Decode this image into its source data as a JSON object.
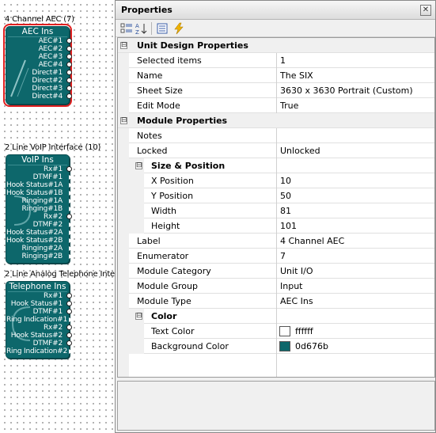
{
  "canvas": {
    "modules": [
      {
        "caption": "4 Channel AEC (7)",
        "title": "AEC Ins",
        "pins": [
          "AEC#1",
          "AEC#2",
          "AEC#3",
          "AEC#4",
          "Direct#1",
          "Direct#2",
          "Direct#3",
          "Direct#4"
        ]
      },
      {
        "caption": "2 Line VoIP Interface (10)",
        "title": "VoIP Ins",
        "pins": [
          "Rx#1",
          "DTMF#1",
          "Hook Status#1A",
          "Hook Status#1B",
          "Ringing#1A",
          "Ringing#1B",
          "Rx#2",
          "DTMF#2",
          "Hook Status#2A",
          "Hook Status#2B",
          "Ringing#2A",
          "Ringing#2B"
        ]
      },
      {
        "caption": "2 Line Analog Telephone Inte",
        "title": "Telephone Ins",
        "pins": [
          "Rx#1",
          "Hook Status#1",
          "DTMF#1",
          "Ring Indication#1",
          "Rx#2",
          "Hook Status#2",
          "DTMF#2",
          "Ring Indication#2"
        ]
      }
    ]
  },
  "properties": {
    "window_title": "Properties",
    "close_icon": "close-icon",
    "toolbar": {
      "categorized": "categorized-icon",
      "alphabetical": "sort-alpha-icon",
      "property_pages": "property-pages-icon",
      "events": "lightning-icon"
    },
    "unit_design": {
      "label": "Unit Design Properties",
      "toggle": "⊟",
      "selected_items": {
        "name": "Selected items",
        "value": "1"
      },
      "name": {
        "name": "Name",
        "value": "The SIX"
      },
      "sheet_size": {
        "name": "Sheet Size",
        "value": "3630 x 3630 Portrait (Custom)"
      },
      "edit_mode": {
        "name": "Edit Mode",
        "value": "True"
      }
    },
    "module": {
      "label": "Module Properties",
      "toggle": "⊟",
      "notes": {
        "name": "Notes",
        "value": ""
      },
      "locked": {
        "name": "Locked",
        "value": "Unlocked"
      },
      "size_position": {
        "label": "Size & Position",
        "toggle": "⊟",
        "x": {
          "name": "X Position",
          "value": "10"
        },
        "y": {
          "name": "Y Position",
          "value": "50"
        },
        "width": {
          "name": "Width",
          "value": "81"
        },
        "height": {
          "name": "Height",
          "value": "101"
        }
      },
      "label_prop": {
        "name": "Label",
        "value": "4 Channel AEC"
      },
      "enumerator": {
        "name": "Enumerator",
        "value": "7"
      },
      "category": {
        "name": "Module Category",
        "value": "Unit I/O"
      },
      "group": {
        "name": "Module Group",
        "value": "Input"
      },
      "type": {
        "name": "Module Type",
        "value": "AEC Ins"
      },
      "color": {
        "label": "Color",
        "toggle": "⊟",
        "text_color": {
          "name": "Text Color",
          "value": "ffffff",
          "swatch": "#ffffff"
        },
        "background_color": {
          "name": "Background Color",
          "value": "0d676b",
          "swatch": "#0d676b"
        }
      }
    }
  }
}
